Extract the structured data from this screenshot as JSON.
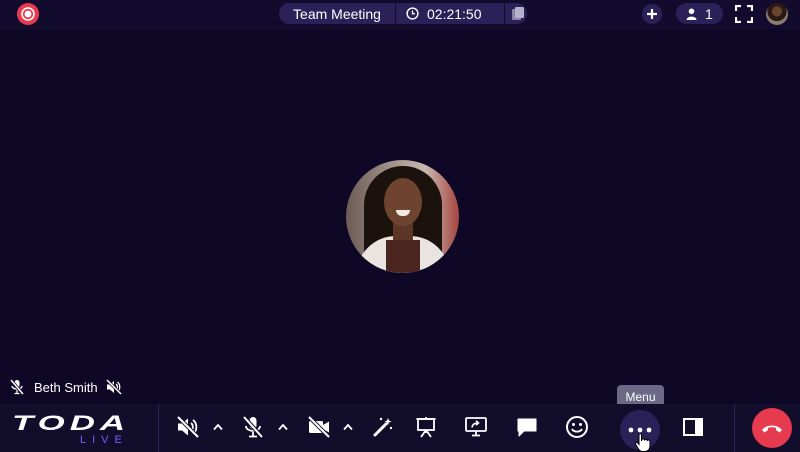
{
  "header": {
    "meeting_title": "Team Meeting",
    "timer": "02:21:50",
    "participant_count": "1"
  },
  "participant": {
    "name": "Beth Smith"
  },
  "toolbar": {
    "menu_tooltip": "Menu",
    "logo_text": "TODA",
    "logo_subtext": "LIVE"
  },
  "colors": {
    "background": "#0e0826",
    "bar": "#130d2c",
    "pill": "#2a2158",
    "record_red": "#e63b4f",
    "hangup_red": "#e63b4f",
    "logo_purple": "#7b5cff"
  },
  "icons": {
    "record": "record-icon",
    "clock": "clock-icon",
    "copy": "copy-icon",
    "add": "plus-icon",
    "participants": "person-icon",
    "fullscreen": "fullscreen-icon",
    "speaker_off": "speaker-muted-icon",
    "mic_off": "mic-muted-icon",
    "camera_off": "camera-off-icon",
    "effects": "magic-wand-icon",
    "whiteboard": "presentation-board-icon",
    "share_screen": "share-screen-icon",
    "chat": "chat-icon",
    "reactions": "smiley-icon",
    "menu": "more-icon",
    "layout": "sidebar-layout-icon",
    "hangup": "phone-hangup-icon"
  }
}
